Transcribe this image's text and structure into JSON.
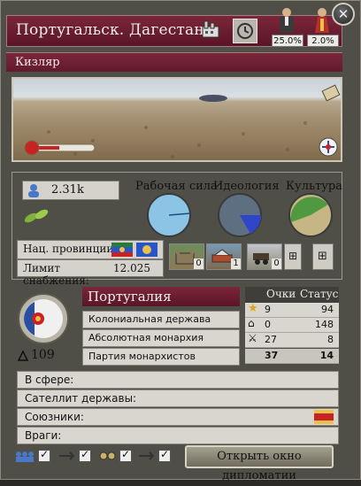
{
  "header": {
    "title": "Португальск. Дагестан",
    "province": "Кизляр",
    "pop_type_1_pct": "25.0%",
    "pop_type_2_pct": "2.0%"
  },
  "stats": {
    "population": "2.31k",
    "labels": {
      "workforce": "Рабочая сила",
      "ideology": "Идеология",
      "culture": "Культура"
    },
    "national_provinces_label": "Нац. провинции:",
    "supply_limit_label": "Лимит снабжения:",
    "supply_limit_value": "12.025",
    "building_counts": [
      "0",
      "1",
      "0"
    ]
  },
  "nation": {
    "name": "Португалия",
    "traits": [
      "Колониальная держава",
      "Абсолютная монархия",
      "Партия монархистов"
    ],
    "prestige": "109",
    "scores_header": {
      "points": "Очки",
      "status": "Статус"
    },
    "scores": [
      {
        "icon": "star-icon",
        "points": "9",
        "status": "94"
      },
      {
        "icon": "factory-icon",
        "points": "0",
        "status": "148"
      },
      {
        "icon": "swords-icon",
        "points": "27",
        "status": "8"
      }
    ],
    "total": {
      "points": "37",
      "status": "14"
    }
  },
  "relations": {
    "sphere": "В сфере:",
    "satellite": "Сателлит державы:",
    "allies": "Союзники:",
    "enemies": "Враги:"
  },
  "footer": {
    "diplomacy_button": "Открыть окно дипломатии"
  }
}
